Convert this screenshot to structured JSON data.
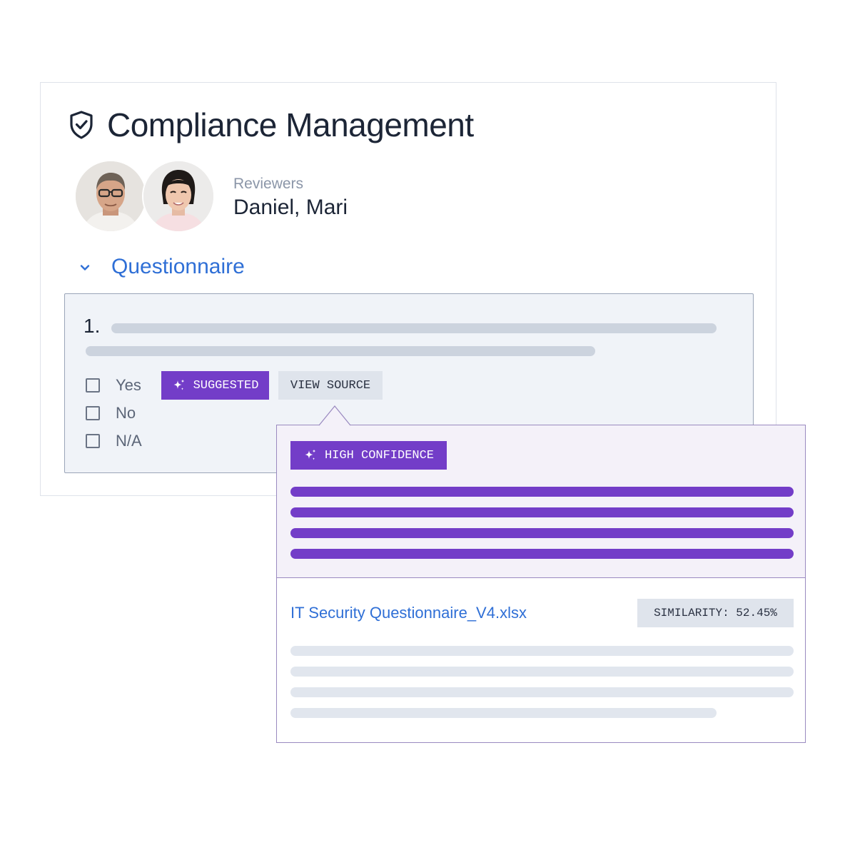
{
  "header": {
    "title": "Compliance Management",
    "icon": "shield-check-icon"
  },
  "reviewers": {
    "label": "Reviewers",
    "names": "Daniel, Mari",
    "avatars": [
      "avatar-daniel",
      "avatar-mari"
    ]
  },
  "section": {
    "title": "Questionnaire",
    "icon": "chevron-down-icon",
    "expanded": true
  },
  "question": {
    "number": "1.",
    "options": [
      {
        "label": "Yes",
        "checked": false
      },
      {
        "label": "No",
        "checked": false
      },
      {
        "label": "N/A",
        "checked": false
      }
    ],
    "suggested_label": "SUGGESTED",
    "view_source_label": "VIEW SOURCE"
  },
  "source_popover": {
    "confidence_label": "HIGH CONFIDENCE",
    "file_name": "IT Security Questionnaire_V4.xlsx",
    "similarity_label": "SIMILARITY: 52.45%"
  },
  "colors": {
    "accent_purple": "#733dc8",
    "link_blue": "#2f6fd6",
    "text_dark": "#1c2536",
    "muted": "#8b96a8",
    "skeleton": "#ccd3de"
  }
}
